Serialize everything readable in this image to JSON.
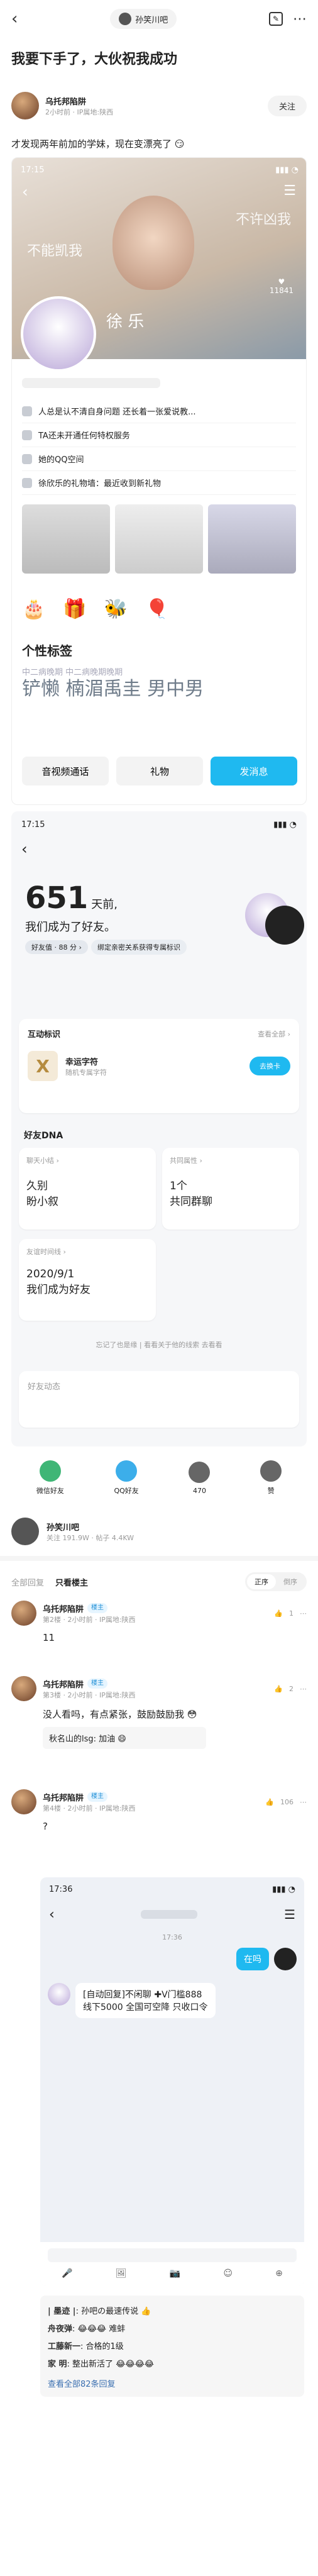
{
  "top": {
    "forum_name": "孙笑川吧",
    "title": "我要下手了，大伙祝我成功",
    "op": {
      "name": "乌托邦陷阱",
      "meta": "2小时前 · IP属地:陕西",
      "follow": "关注",
      "body": "才发现两年前加的学妹，现在变漂亮了",
      "emoji": "😏"
    }
  },
  "shot1": {
    "time": "17:15",
    "banner_text": "不许凶我",
    "banner_text2": "不能凯我",
    "likes": "11841",
    "name": "徐 乐",
    "items": [
      {
        "icon": "pen-icon",
        "text": "人总是认不清自身问题 还长着一张爱说教..."
      },
      {
        "icon": "tag-icon",
        "text": "TA还未开通任何特权服务"
      },
      {
        "icon": "space-icon",
        "text": "她的QQ空间"
      },
      {
        "icon": "gift-icon",
        "text": "徐欣乐的礼物墙：最近收到新礼物"
      }
    ],
    "section": "个性标签",
    "marquee": "铲懒  楠湄禹圭  男中男",
    "marquee_small": "中二病晚期 中二病晚期晚期",
    "buttons": [
      "音视频通话",
      "礼物",
      "发消息"
    ]
  },
  "shot2": {
    "time": "17:15",
    "days": "651",
    "days_unit": "天前,",
    "line2": "我们成为了好友。",
    "tag": "好友值 · 88 分 ›",
    "hint": "绑定亲密关系获得专属标识",
    "interaction_title": "互动标识",
    "view_all": "查看全部 ›",
    "badge_name": "幸运字符",
    "badge_sub": "随机专属字符",
    "badge_btn": "去换卡",
    "dna_title": "好友DNA",
    "chat_cell_title": "聊天小结 ›",
    "chat_cell_value": "久别\n盼小叙",
    "common_title": "共同属性 ›",
    "common_value": "1个\n共同群聊",
    "time_title": "友谊时间线 ›",
    "time_value": "2020/9/1\n我们成为好友",
    "forgot": "忘记了也是缘 | 看看关于他的线索 去看看",
    "news": "好友动态"
  },
  "share": {
    "items": [
      {
        "label": "微信好友",
        "icon": "wechat-icon",
        "color": "#2aae67"
      },
      {
        "label": "QQ好友",
        "icon": "qq-icon",
        "color": "#27a5e8"
      },
      {
        "label": "470",
        "icon": "thumb-icon",
        "color": "#555"
      },
      {
        "label": "赞",
        "icon": "more-icon",
        "color": "#555"
      }
    ]
  },
  "author": {
    "name": "孙笑川吧",
    "meta": "关注 191.9W · 帖子 4.4KW"
  },
  "filter": {
    "tabs": [
      "全部回复",
      "只看楼主"
    ],
    "sort": [
      "正序",
      "倒序"
    ]
  },
  "replies": [
    {
      "name": "乌托邦陷阱",
      "badge": "楼主",
      "meta": "第2楼 · 2小时前 · IP属地:陕西",
      "body": "11",
      "likes": "1"
    },
    {
      "name": "乌托邦陷阱",
      "badge": "楼主",
      "meta": "第3楼 · 2小时前 · IP属地:陕西",
      "body": "没人看吗，有点紧张，鼓励鼓励我",
      "emoji": "😳",
      "likes": "2",
      "sub": "秋名山的lsg: 加油",
      "sub_emoji": "😄"
    },
    {
      "name": "乌托邦陷阱",
      "badge": "楼主",
      "meta": "第4楼 · 2小时前 · IP属地:陕西",
      "body": "?",
      "likes": "106"
    }
  ],
  "chat": {
    "time": "17:36",
    "stamp": "17:36",
    "me_msg": "在吗",
    "her_msg": "[自动回复]不闲聊 ✚V门槛888\n线下5000 全国可空降 只收口令"
  },
  "comments": {
    "items": [
      {
        "name": "| 墨迹 |",
        "text": "孙吧の最速传说",
        "emoji": "👍"
      },
      {
        "name": "舟夜弹",
        "text": "",
        "emoji": "😂😂😂 难蚌"
      },
      {
        "name": "工藤新一",
        "text": "合格的1级",
        "emoji": ""
      },
      {
        "name": "家 明",
        "text": "整出新活了",
        "emoji": "😂😂😂😂"
      }
    ],
    "more": "查看全部82条回复"
  }
}
